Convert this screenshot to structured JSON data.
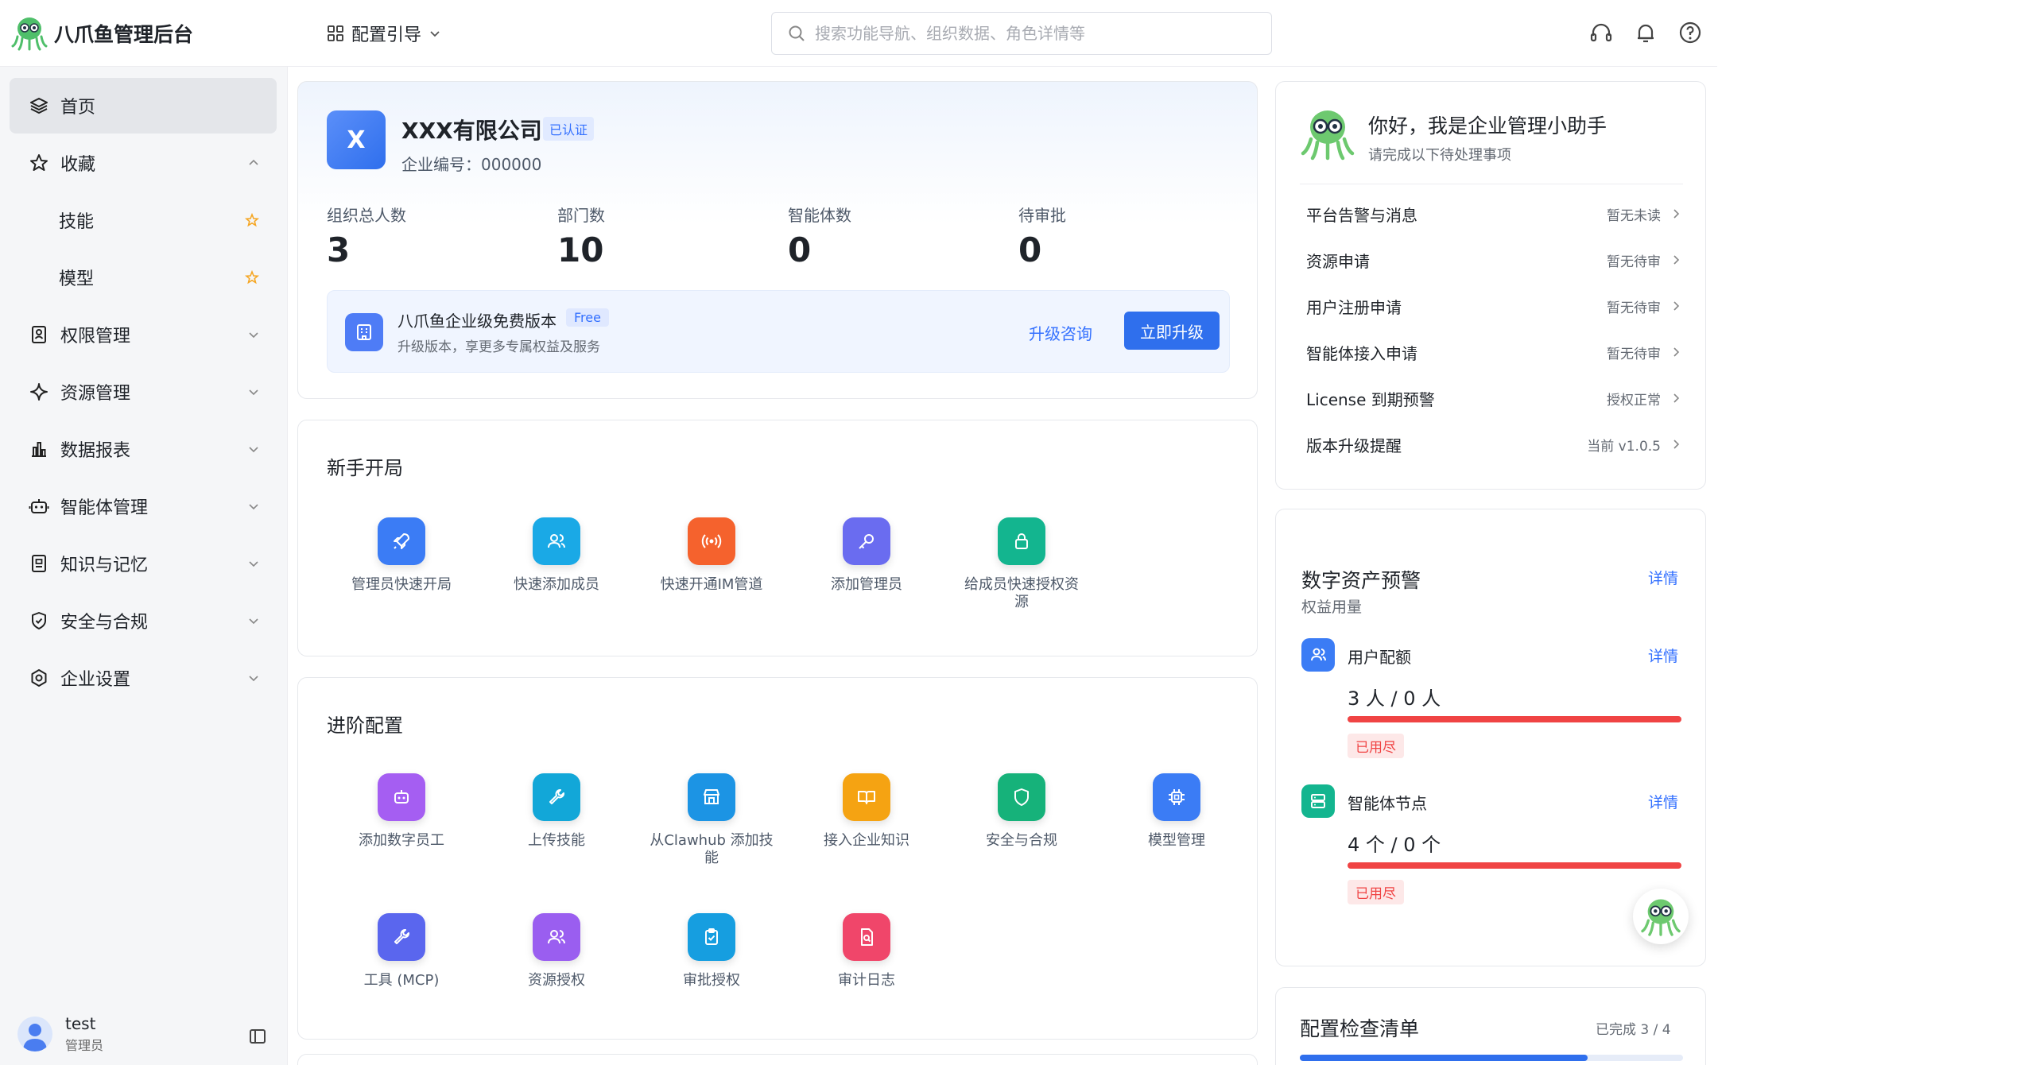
{
  "header": {
    "app_title": "八爪鱼管理后台",
    "guide_label": "配置引导",
    "search_placeholder": "搜索功能导航、组织数据、角色详情等"
  },
  "sidebar": {
    "items": [
      {
        "label": "首页",
        "icon": "layers-icon"
      },
      {
        "label": "收藏",
        "icon": "star-icon"
      },
      {
        "label": "技能",
        "icon": "star-icon"
      },
      {
        "label": "模型",
        "icon": "star-icon"
      },
      {
        "label": "权限管理",
        "icon": "id-card-icon"
      },
      {
        "label": "资源管理",
        "icon": "sparkle-icon"
      },
      {
        "label": "数据报表",
        "icon": "bar-chart-icon"
      },
      {
        "label": "智能体管理",
        "icon": "robot-icon"
      },
      {
        "label": "知识与记忆",
        "icon": "book-icon"
      },
      {
        "label": "安全与合规",
        "icon": "shield-icon"
      },
      {
        "label": "企业设置",
        "icon": "settings-icon"
      }
    ],
    "user": {
      "name": "test",
      "role": "管理员"
    }
  },
  "company": {
    "logo_letter": "X",
    "name": "XXX有限公司",
    "verified": "已认证",
    "id_text": "企业编号：000000",
    "stats": [
      {
        "label": "组织总人数",
        "value": "3"
      },
      {
        "label": "部门数",
        "value": "10"
      },
      {
        "label": "智能体数",
        "value": "0"
      },
      {
        "label": "待审批",
        "value": "0"
      }
    ],
    "upgrade": {
      "title": "八爪鱼企业级免费版本",
      "tag": "Free",
      "desc": "升级版本，享更多专属权益及服务",
      "consult": "升级咨询",
      "button": "立即升级"
    }
  },
  "beginner": {
    "title": "新手开局",
    "tiles": [
      {
        "label": "管理员快速开局",
        "color": "#3b7cf5"
      },
      {
        "label": "快速添加成员",
        "color": "#1aa9e6"
      },
      {
        "label": "快速开通IM管道",
        "color": "#f5622d"
      },
      {
        "label": "添加管理员",
        "color": "#6a6cf0"
      },
      {
        "label": "给成员快速授权资源",
        "color": "#13b58f"
      }
    ]
  },
  "advanced": {
    "title": "进阶配置",
    "tiles": [
      {
        "label": "添加数字员工",
        "color": "#a55ef2"
      },
      {
        "label": "上传技能",
        "color": "#12a7d8"
      },
      {
        "label": "从Clawhub 添加技能",
        "color": "#1c94e4"
      },
      {
        "label": "接入企业知识",
        "color": "#f5a312"
      },
      {
        "label": "安全与合规",
        "color": "#16b27a"
      },
      {
        "label": "模型管理",
        "color": "#3b7cf5"
      },
      {
        "label": "工具 (MCP)",
        "color": "#5a66ee"
      },
      {
        "label": "资源授权",
        "color": "#9a5ef0"
      },
      {
        "label": "审批授权",
        "color": "#169ee0"
      },
      {
        "label": "审计日志",
        "color": "#f0466a"
      }
    ]
  },
  "assistant": {
    "title": "你好，我是企业管理小助手",
    "subtitle": "请完成以下待处理事项",
    "todos": [
      {
        "label": "平台告警与消息",
        "status": "暂无未读"
      },
      {
        "label": "资源申请",
        "status": "暂无待审"
      },
      {
        "label": "用户注册申请",
        "status": "暂无待审"
      },
      {
        "label": "智能体接入申请",
        "status": "暂无待审"
      },
      {
        "label": "License 到期预警",
        "status": "授权正常"
      },
      {
        "label": "版本升级提醒",
        "status": "当前 v1.0.5"
      }
    ]
  },
  "assets": {
    "title": "数字资产预警",
    "detail": "详情",
    "subtitle": "权益用量",
    "quotas": [
      {
        "name": "用户配额",
        "detail": "详情",
        "value": "3 人 / 0 人",
        "tag": "已用尽",
        "usage_percent": 100,
        "color": "#3b7cf5"
      },
      {
        "name": "智能体节点",
        "detail": "详情",
        "value": "4 个 / 0 个",
        "tag": "已用尽",
        "usage_percent": 100,
        "color": "#13b58f"
      }
    ]
  },
  "checklist": {
    "title": "配置检查清单",
    "progress_text": "已完成 3 / 4",
    "done": 3,
    "total": 4
  }
}
